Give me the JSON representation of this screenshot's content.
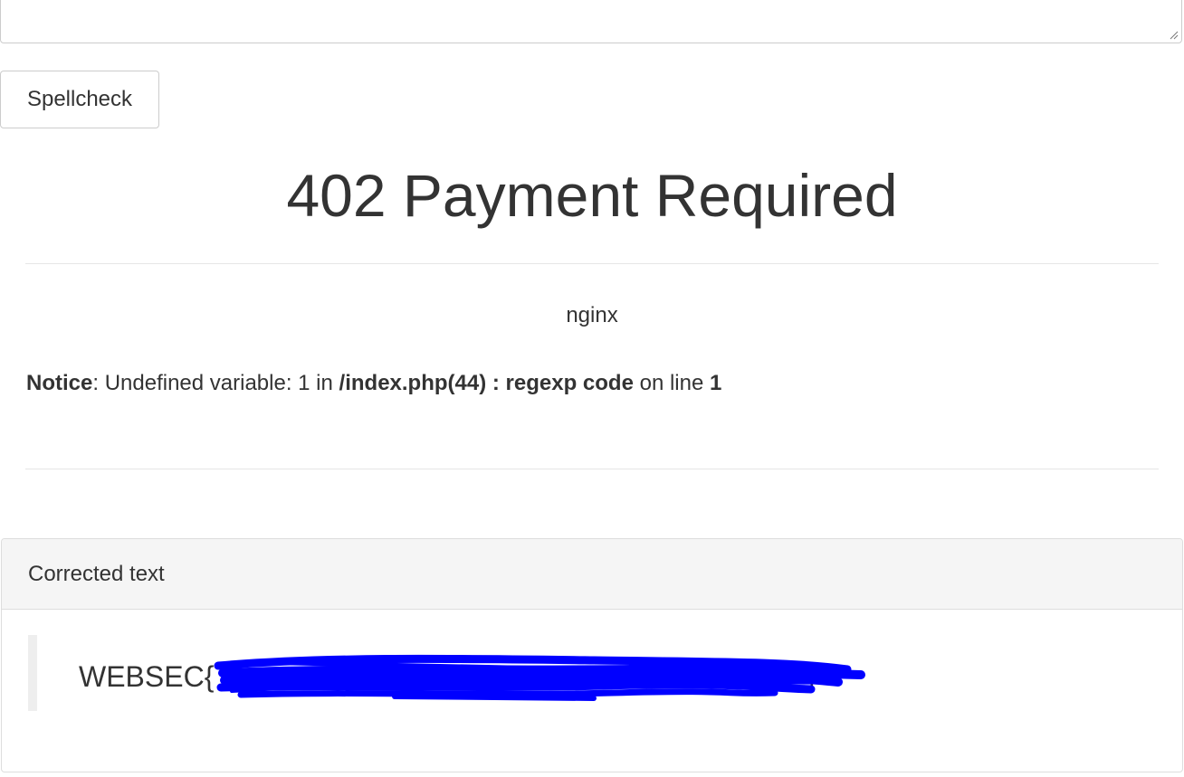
{
  "form": {
    "text_value": "",
    "button_label": "Spellcheck"
  },
  "error": {
    "title": "402 Payment Required",
    "server": "nginx"
  },
  "notice": {
    "label": "Notice",
    "message": ": Undefined variable: 1 in ",
    "file": "/index.php(44) : regexp code",
    "on_line": " on line ",
    "line": "1"
  },
  "result": {
    "heading": "Corrected text",
    "flag_prefix": "WEBSEC{",
    "flag_suffix": "}"
  },
  "colors": {
    "redaction": "#0000ff",
    "panel_heading_bg": "#f5f5f5",
    "text": "#333333"
  }
}
